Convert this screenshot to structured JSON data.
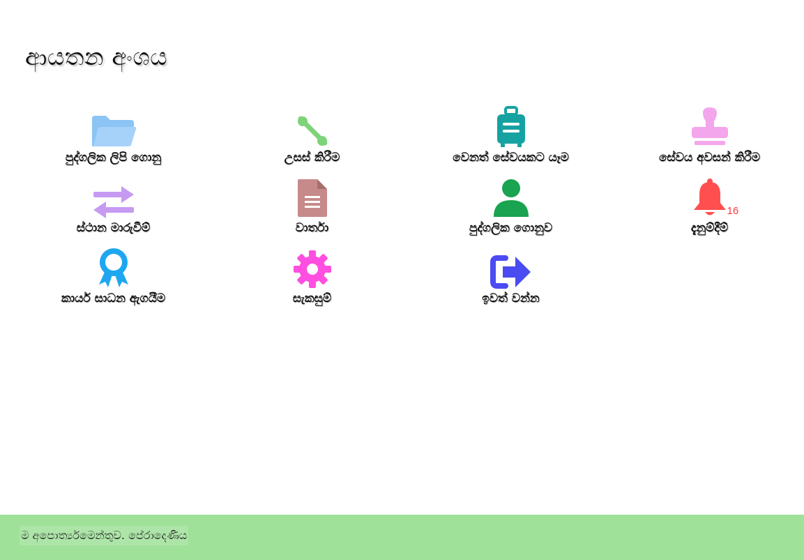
{
  "page": {
    "title": "ආයතන අංශය"
  },
  "tiles": [
    {
      "label": "පුද්ගලික ලිපි ගොනු",
      "icon": "folder-icon",
      "color": "#8cc4f5"
    },
    {
      "label": "උසස් කිරීම",
      "icon": "percent-icon",
      "color": "#7ed37a"
    },
    {
      "label": "වෙනත් සේවයකට යෑම",
      "icon": "suitcase-icon",
      "color": "#17a2a2"
    },
    {
      "label": "සේවය අවසන් කිරීම",
      "icon": "stamp-icon",
      "color": "#f4a6ec"
    },
    {
      "label": "ස්ථාන මාරුවීම්",
      "icon": "exchange-arrows-icon",
      "color": "#c79af2"
    },
    {
      "label": "වාර්තා",
      "icon": "document-icon",
      "color": "#c78a8a"
    },
    {
      "label": "පුද්ගලික ගොනුව",
      "icon": "user-icon",
      "color": "#1aa350"
    },
    {
      "label": "දැනුම්දීම්",
      "icon": "bell-icon",
      "color": "#ff4f4f",
      "badge": "16"
    },
    {
      "label": "කාර්ය සාධන ඇගයීම",
      "icon": "award-ribbon-icon",
      "color": "#1ea7f0"
    },
    {
      "label": "සැකසුම්",
      "icon": "gear-icon",
      "color": "#ff4fe0"
    },
    {
      "label": "ඉවත් වන්න",
      "icon": "sign-out-icon",
      "color": "#4b4bf2"
    }
  ],
  "footer": {
    "text": "ම අපොර්ත්‍යමෙන්තුව. පේරාදෙණිය",
    "background": "#9fe199"
  }
}
